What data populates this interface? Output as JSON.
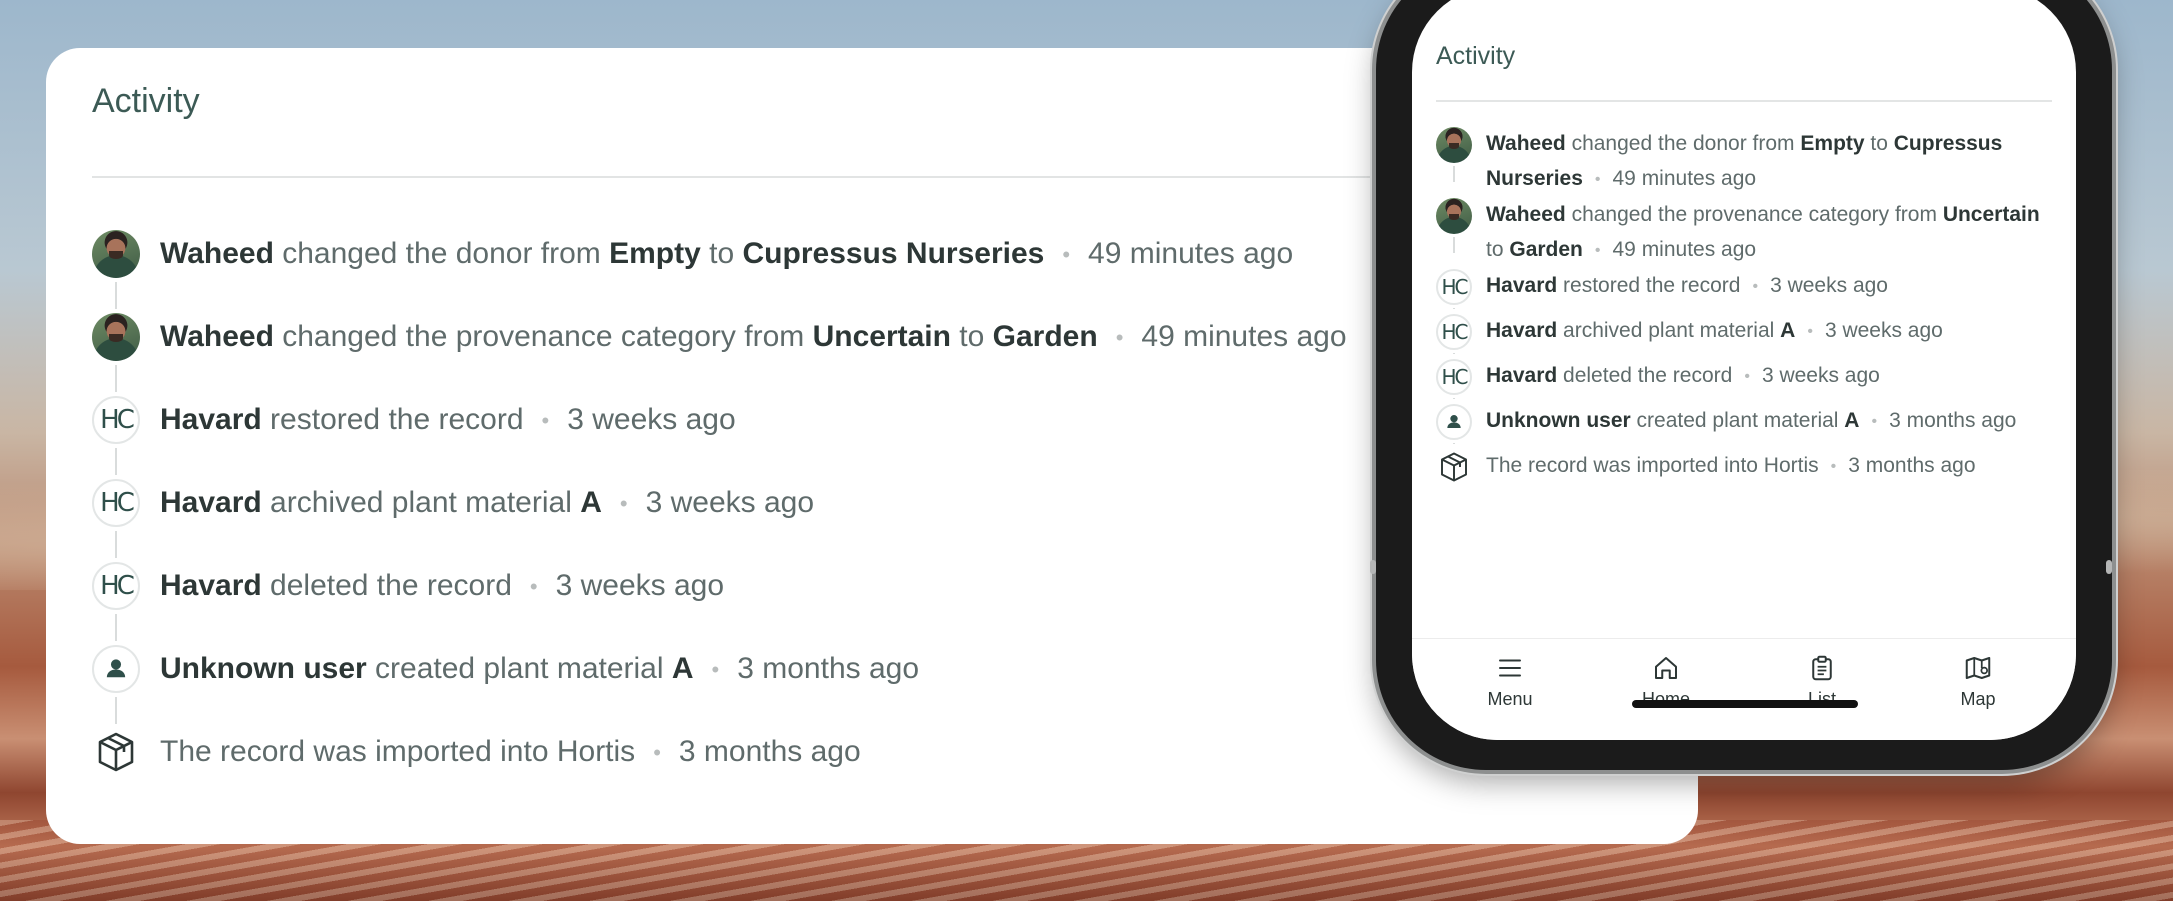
{
  "desktop": {
    "title": "Activity",
    "items": [
      {
        "avatar": "photo",
        "actor": "Waheed",
        "parts": [
          " changed the donor from ",
          "Empty",
          " to ",
          "Cupressus Nurseries"
        ],
        "time": "49 minutes ago"
      },
      {
        "avatar": "photo",
        "actor": "Waheed",
        "parts": [
          " changed the provenance category from ",
          "Uncertain",
          " to ",
          "Garden"
        ],
        "time": "49 minutes ago"
      },
      {
        "avatar": "hc",
        "actor": "Havard",
        "parts": [
          " restored the record"
        ],
        "time": "3 weeks ago"
      },
      {
        "avatar": "hc",
        "actor": "Havard",
        "parts": [
          " archived plant material ",
          "A"
        ],
        "time": "3 weeks ago"
      },
      {
        "avatar": "hc",
        "actor": "Havard",
        "parts": [
          " deleted the record"
        ],
        "time": "3 weeks ago"
      },
      {
        "avatar": "user",
        "actor": "Unknown user",
        "parts": [
          " created plant material ",
          "A"
        ],
        "time": "3 months ago"
      },
      {
        "avatar": "box",
        "actor": "",
        "parts": [
          "The record was imported into Hortis"
        ],
        "time": "3 months ago"
      }
    ]
  },
  "hc_initials": "HC",
  "phone": {
    "title": "Activity",
    "items": [
      {
        "avatar": "photo",
        "actor": "Waheed",
        "parts": [
          " changed the donor from ",
          "Empty",
          " to ",
          "Cupressus Nurseries"
        ],
        "time": "49 minutes ago"
      },
      {
        "avatar": "photo",
        "actor": "Waheed",
        "parts": [
          " changed the provenance category from ",
          "Uncertain",
          " to ",
          "Garden"
        ],
        "time": "49 minutes ago"
      },
      {
        "avatar": "hc",
        "actor": "Havard",
        "parts": [
          " restored the record"
        ],
        "time": "3 weeks ago"
      },
      {
        "avatar": "hc",
        "actor": "Havard",
        "parts": [
          " archived plant material ",
          "A"
        ],
        "time": "3 weeks ago"
      },
      {
        "avatar": "hc",
        "actor": "Havard",
        "parts": [
          " deleted the record"
        ],
        "time": "3 weeks ago"
      },
      {
        "avatar": "user",
        "actor": "Unknown user",
        "parts": [
          " created plant material ",
          "A"
        ],
        "time": "3 months ago"
      },
      {
        "avatar": "box",
        "actor": "",
        "parts": [
          "The record was imported into Hortis"
        ],
        "time": "3 months ago"
      }
    ],
    "tabs": [
      {
        "label": "Menu",
        "icon": "menu-icon"
      },
      {
        "label": "Home",
        "icon": "home-icon"
      },
      {
        "label": "List",
        "icon": "clipboard-icon"
      },
      {
        "label": "Map",
        "icon": "map-icon"
      }
    ]
  },
  "colors": {
    "title": "#3c5a55",
    "text": "#5f6b6b",
    "bold": "#2d3736"
  }
}
